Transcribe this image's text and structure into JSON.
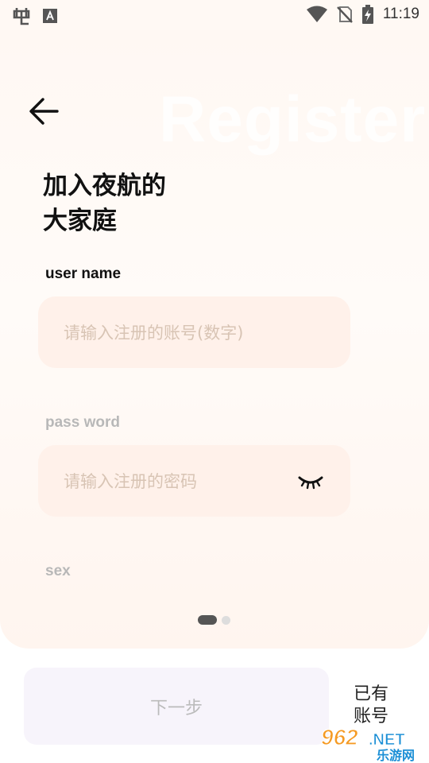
{
  "status_bar": {
    "time": "11:19",
    "icons": [
      "app-bug-icon",
      "app-a-icon",
      "wifi-icon",
      "no-signal-icon",
      "battery-charging-icon"
    ]
  },
  "header": {
    "watermark": "Register",
    "title_line1": "加入夜航的",
    "title_line2": "大家庭"
  },
  "form": {
    "username_label": "user name",
    "username_placeholder": "请输入注册的账号(数字)",
    "password_label": "pass word",
    "password_placeholder": "请输入注册的密码",
    "sex_label": "sex"
  },
  "pager": {
    "pages": 2,
    "current": 1
  },
  "footer": {
    "next_label": "下一步",
    "login_line1": "已有",
    "login_line2": "账号"
  },
  "site_watermark": {
    "number": "962",
    "suffix": ".NET",
    "name": "乐游网"
  },
  "colors": {
    "card_bg": "#fff8f3",
    "input_bg": "#fff1ea",
    "placeholder": "#d8c4b4",
    "next_bg": "#f7f4fb",
    "watermark_orange": "#f59a23",
    "watermark_blue": "#1b8fd6"
  }
}
